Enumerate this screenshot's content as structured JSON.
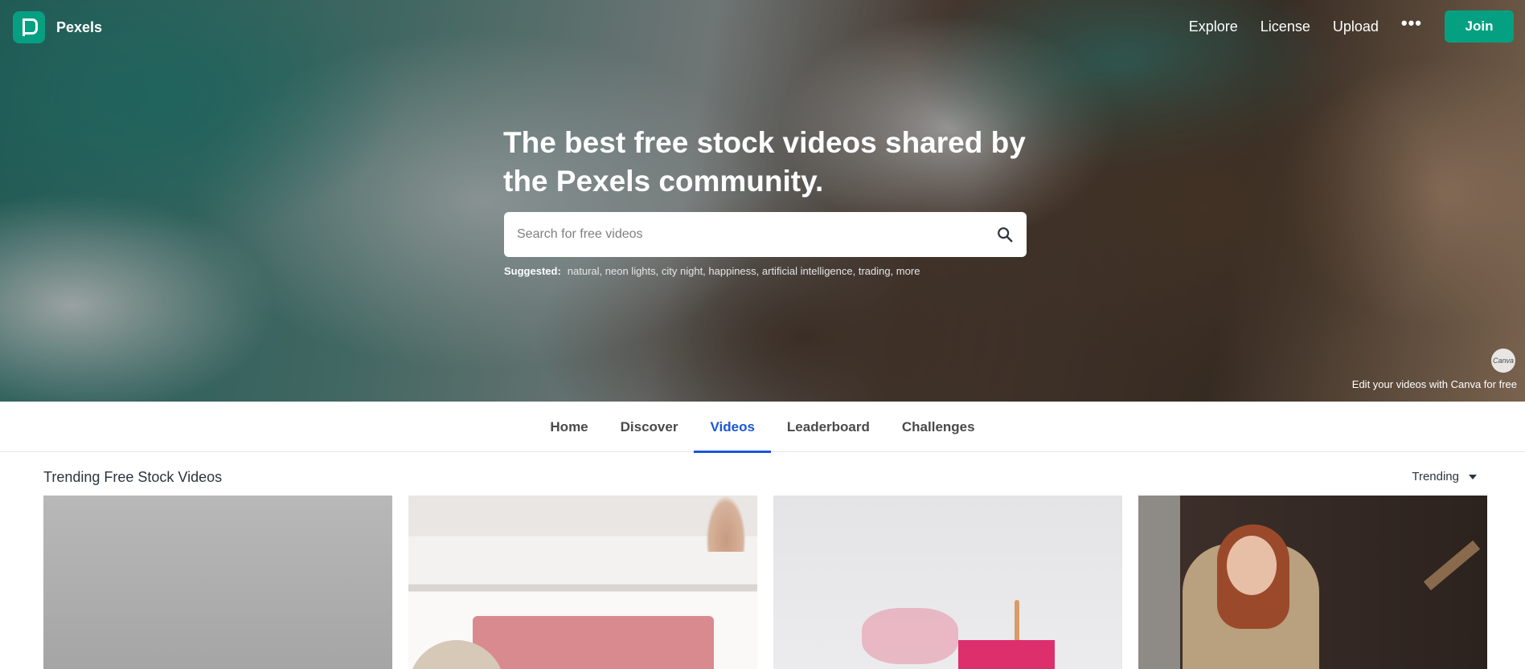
{
  "brand": {
    "name": "Pexels",
    "accent": "#05a081"
  },
  "nav": {
    "links": [
      "Explore",
      "License",
      "Upload"
    ],
    "more_icon": "more-horizontal-icon",
    "join_label": "Join"
  },
  "hero": {
    "title": "The best free stock videos shared by the Pexels community.",
    "search": {
      "placeholder": "Search for free videos",
      "value": "",
      "icon": "search-icon"
    },
    "suggested_label": "Suggested:",
    "suggested_items": "natural, neon lights, city night, happiness, artificial intelligence, trading, more",
    "canva_badge": "Canva",
    "canva_caption": "Edit your videos with Canva for free"
  },
  "tabs": [
    {
      "label": "Home",
      "active": false
    },
    {
      "label": "Discover",
      "active": false
    },
    {
      "label": "Videos",
      "active": true
    },
    {
      "label": "Leaderboard",
      "active": false
    },
    {
      "label": "Challenges",
      "active": false
    }
  ],
  "section": {
    "title": "Trending Free Stock Videos",
    "sort_label": "Trending",
    "active_tab_color": "#1a56db"
  }
}
